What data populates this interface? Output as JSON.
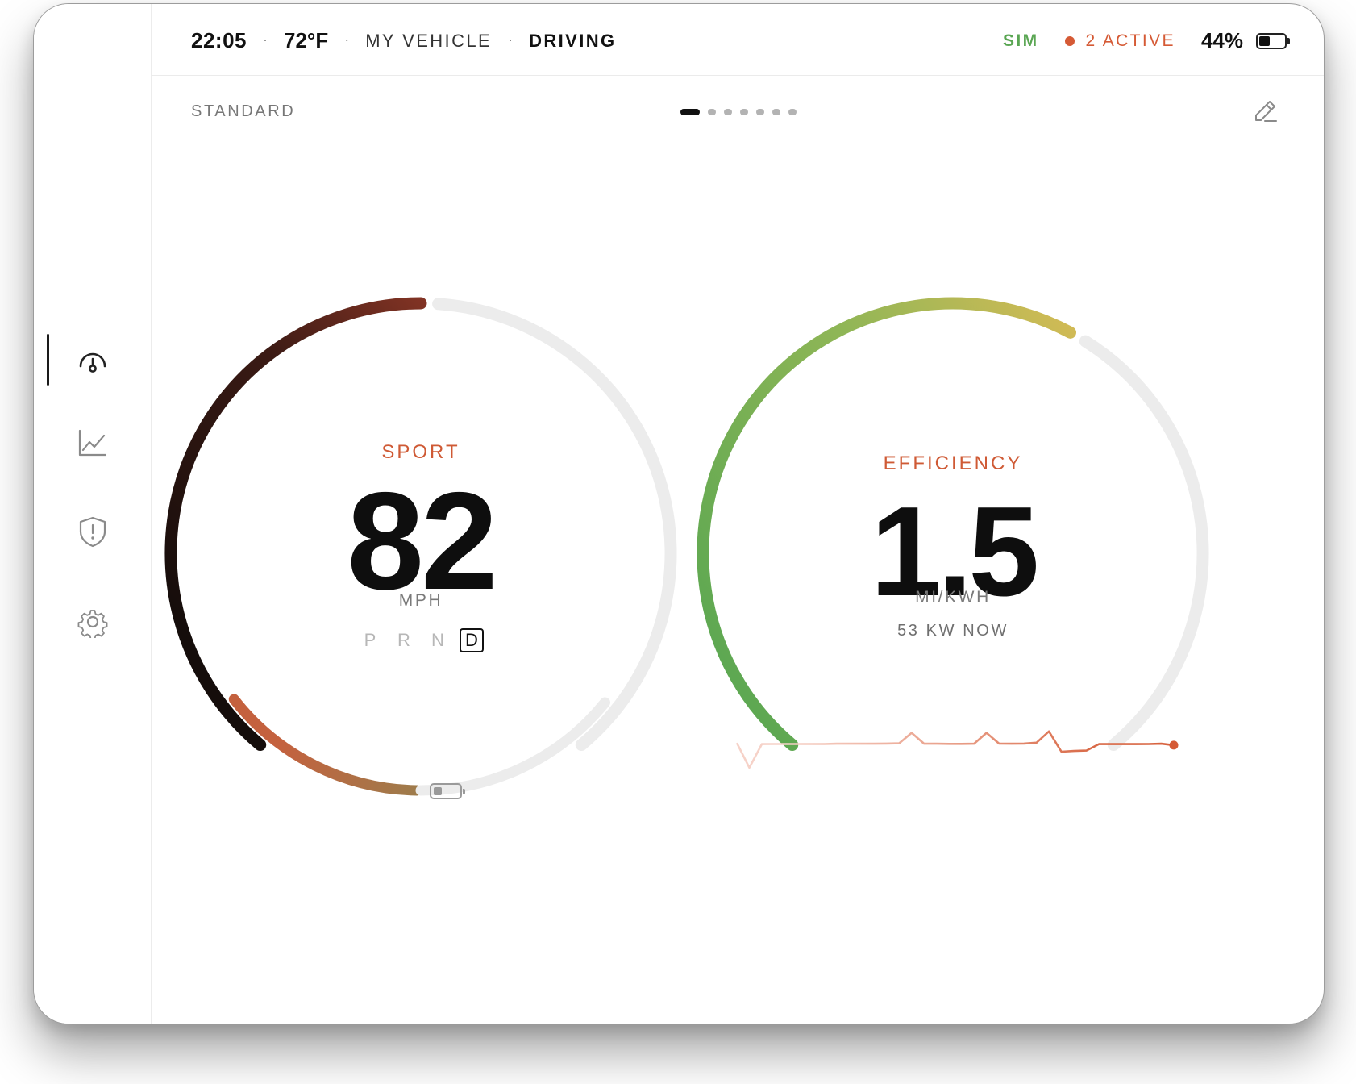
{
  "status_bar": {
    "time": "22:05",
    "temperature": "72°F",
    "vehicle": "MY VEHICLE",
    "mode": "DRIVING",
    "separator": "·",
    "sim_label": "SIM",
    "alerts_label": "2 ACTIVE",
    "battery_percent": "44%",
    "battery_level": 0.44
  },
  "sidebar": {
    "items": [
      {
        "name": "gauge",
        "icon": "gauge-icon",
        "active": true
      },
      {
        "name": "trends",
        "icon": "chart-line-icon",
        "active": false
      },
      {
        "name": "alerts",
        "icon": "shield-alert-icon",
        "active": false
      },
      {
        "name": "settings",
        "icon": "gear-icon",
        "active": false
      }
    ]
  },
  "subheader": {
    "preset_label": "STANDARD",
    "page_count": 7,
    "current_page": 1,
    "edit_icon": "pencil-icon"
  },
  "speed_gauge": {
    "label": "SPORT",
    "value": "82",
    "unit": "MPH",
    "gears": [
      "P",
      "R",
      "N",
      "D"
    ],
    "selected_gear": "D",
    "speed_fraction": 0.5,
    "battery_fraction": 0.33,
    "battery_icon": "battery-icon"
  },
  "efficiency_gauge": {
    "label": "EFFICIENCY",
    "value": "1.5",
    "unit": "MI/KWH",
    "power_readout": "53 KW NOW",
    "efficiency_fraction": 0.6,
    "history": [
      0.1,
      -1.6,
      0.02,
      0.03,
      0.03,
      0.03,
      0.03,
      0.03,
      0.05,
      0.05,
      0.05,
      0.05,
      0.06,
      0.08,
      0.8,
      0.05,
      0.05,
      0.04,
      0.04,
      0.05,
      0.8,
      0.06,
      0.05,
      0.06,
      0.12,
      0.9,
      -0.5,
      -0.45,
      -0.42,
      0.02,
      0.02,
      0.02,
      0.02,
      0.03,
      0.05,
      -0.05
    ]
  },
  "colors": {
    "accent": "#d55a35",
    "sim_green": "#5aa653",
    "track": "#ececec",
    "text_dark": "#0e0e0e"
  }
}
